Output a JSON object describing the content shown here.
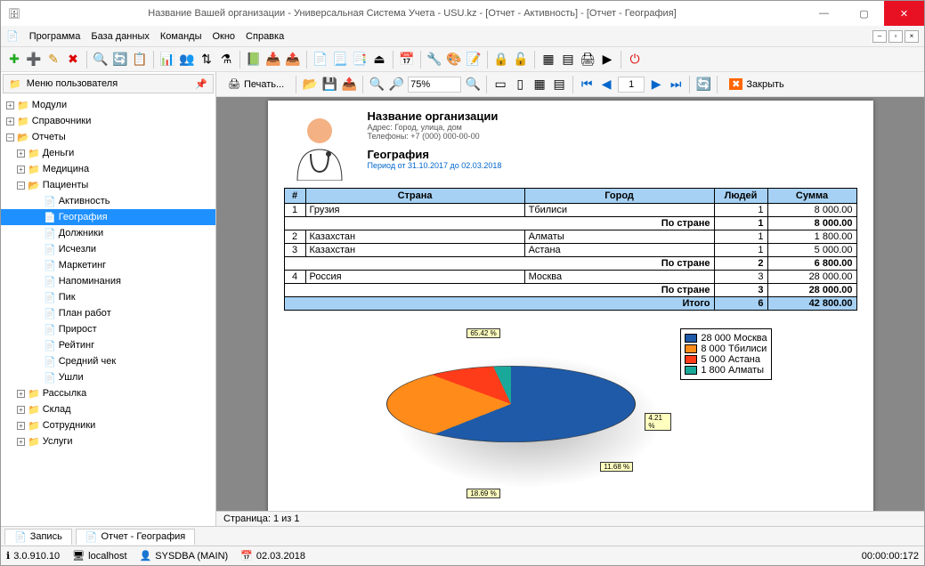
{
  "window": {
    "title": "Название Вашей организации - Универсальная Система Учета - USU.kz - [Отчет - Активность] - [Отчет - География]"
  },
  "menu": {
    "m1": "Программа",
    "m2": "База данных",
    "m3": "Команды",
    "m4": "Окно",
    "m5": "Справка"
  },
  "sidebar": {
    "title": "Меню пользователя",
    "n_modules": "Модули",
    "n_sprav": "Справочники",
    "n_reports": "Отчеты",
    "r_money": "Деньги",
    "r_med": "Медицина",
    "r_pat": "Пациенты",
    "p_act": "Активность",
    "p_geo": "География",
    "p_dol": "Должники",
    "p_isch": "Исчезли",
    "p_mark": "Маркетинг",
    "p_nap": "Напоминания",
    "p_pik": "Пик",
    "p_plan": "План работ",
    "p_pri": "Прирост",
    "p_rei": "Рейтинг",
    "p_chk": "Средний чек",
    "p_ush": "Ушли",
    "r_ras": "Рассылка",
    "r_skl": "Склад",
    "r_sot": "Сотрудники",
    "r_usl": "Услуги"
  },
  "toolbar2": {
    "print": "Печать...",
    "zoom": "75%",
    "page": "1",
    "close": "Закрыть"
  },
  "report": {
    "org": "Название организации",
    "addr": "Адрес: Город, улица, дом",
    "tel": "Телефоны: +7 (000) 000-00-00",
    "title": "География",
    "period": "Период от 31.10.2017 до 02.03.2018",
    "h_num": "#",
    "h_country": "Страна",
    "h_city": "Город",
    "h_people": "Людей",
    "h_sum": "Сумма",
    "subcountry": "По стране",
    "total": "Итого",
    "r1n": "1",
    "r1c": "Грузия",
    "r1t": "Тбилиси",
    "r1p": "1",
    "r1s": "8 000.00",
    "s1p": "1",
    "s1s": "8 000.00",
    "r2n": "2",
    "r2c": "Казахстан",
    "r2t": "Алматы",
    "r2p": "1",
    "r2s": "1 800.00",
    "r3n": "3",
    "r3c": "Казахстан",
    "r3t": "Астана",
    "r3p": "1",
    "r3s": "5 000.00",
    "s2p": "2",
    "s2s": "6 800.00",
    "r4n": "4",
    "r4c": "Россия",
    "r4t": "Москва",
    "r4p": "3",
    "r4s": "28 000.00",
    "s3p": "3",
    "s3s": "28 000.00",
    "tp": "6",
    "ts": "42 800.00",
    "leg1": "28 000 Москва",
    "leg2": "8 000 Тбилиси",
    "leg3": "5 000 Астана",
    "leg4": "1 800 Алматы",
    "pc1": "65.42 %",
    "pc2": "18.69 %",
    "pc3": "11.68 %",
    "pc4": "4.21 %"
  },
  "pgstatus": "Страница: 1 из 1",
  "tabs": {
    "t1": "Запись",
    "t2": "Отчет - География"
  },
  "status": {
    "ver": "3.0.910.10",
    "host": "localhost",
    "user": "SYSDBA (MAIN)",
    "date": "02.03.2018",
    "time": "00:00:00:172"
  },
  "chart_data": {
    "type": "pie",
    "title": "География",
    "series": [
      {
        "name": "Сумма",
        "values": [
          28000,
          8000,
          5000,
          1800
        ]
      }
    ],
    "categories": [
      "Москва",
      "Тбилиси",
      "Астана",
      "Алматы"
    ],
    "percentages": [
      65.42,
      18.69,
      11.68,
      4.21
    ],
    "colors": [
      "#1e5aa8",
      "#ff8c1a",
      "#ff3c1a",
      "#1aa89a"
    ]
  }
}
